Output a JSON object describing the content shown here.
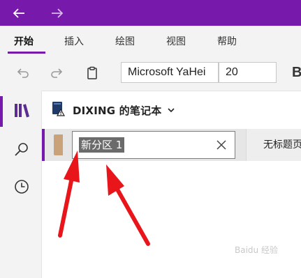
{
  "titlebar": {
    "back_icon": "back-arrow-icon",
    "forward_icon": "forward-arrow-icon",
    "accent": "#7719aa"
  },
  "ribbon": {
    "tabs": [
      {
        "label": "开始",
        "active": true
      },
      {
        "label": "插入",
        "active": false
      },
      {
        "label": "绘图",
        "active": false
      },
      {
        "label": "视图",
        "active": false
      },
      {
        "label": "帮助",
        "active": false
      }
    ]
  },
  "toolbar": {
    "font_name": "Microsoft YaHei",
    "font_size": "20",
    "icons": [
      "undo-icon",
      "redo-icon",
      "clipboard-icon",
      "bold-icon"
    ],
    "bold_label": "B"
  },
  "rail": {
    "items": [
      "notebooks-icon",
      "search-icon",
      "recent-icon"
    ]
  },
  "notebook": {
    "name": "DIXING 的笔记本"
  },
  "section": {
    "rename_value": "新分区 1",
    "color": "#c9a27a"
  },
  "pages": {
    "first_page": "无标题页"
  },
  "annotation": {
    "arrow_color": "#e8161b"
  },
  "watermark": {
    "text": "Baidu 经验"
  }
}
